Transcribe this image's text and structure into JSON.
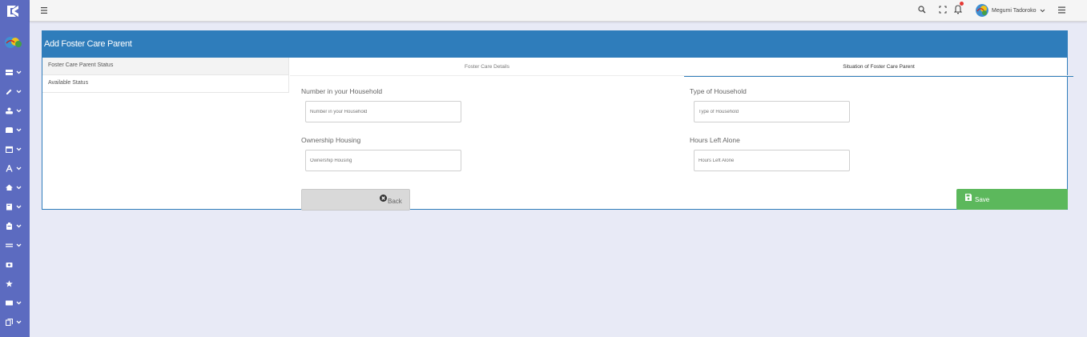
{
  "topbar": {
    "user_name": "Megumi Tadoroko"
  },
  "panel": {
    "title": "Add Foster Care Parent"
  },
  "side_menu": {
    "items": [
      {
        "label": "Foster Care Parent Status",
        "active": true
      },
      {
        "label": "Available Status",
        "active": false
      }
    ]
  },
  "tabs": [
    {
      "label": "Foster Care Details",
      "active": false
    },
    {
      "label": "Situation of Foster Care Parent",
      "active": true
    }
  ],
  "form": {
    "household_number": {
      "label": "Number in your Household",
      "placeholder": "Number in your Household"
    },
    "household_type": {
      "label": "Type of Household",
      "placeholder": "Type of Household"
    },
    "ownership_housing": {
      "label": "Ownership Housing",
      "placeholder": "Ownership Housing"
    },
    "hours_left_alone": {
      "label": "Hours Left Alone",
      "placeholder": "Hours Left Alone"
    }
  },
  "buttons": {
    "back_label": "Back",
    "save_label": "Save"
  },
  "sidebar_icons": [
    "app-logo-icon",
    "organization-logo-icon",
    "storage-icon",
    "edit-icon",
    "group-icon",
    "briefcase-icon",
    "calendar-icon",
    "font-icon",
    "home-icon",
    "book-icon",
    "clipboard-icon",
    "list-icon",
    "camera-icon",
    "star-icon",
    "card-icon",
    "copy-icon"
  ],
  "colors": {
    "sidebar": "#5c6bc0",
    "header": "#2f7dbb",
    "save": "#5cb85c",
    "background": "#e8eaf6"
  }
}
